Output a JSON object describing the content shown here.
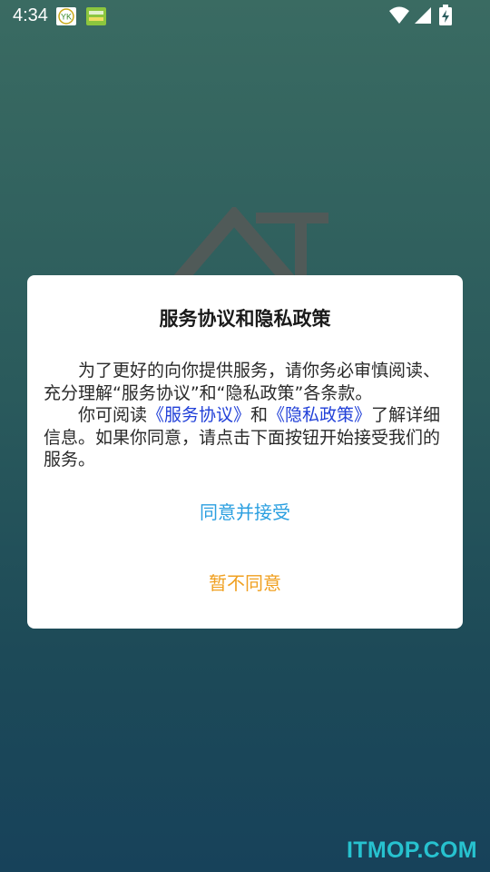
{
  "status_bar": {
    "time": "4:34",
    "app_icon_1_text": "YK",
    "app_icon_2_text": "中国"
  },
  "dialog": {
    "title": "服务协议和隐私政策",
    "para1": "为了更好的向你提供服务，请你务必审慎阅读、充分理解“服务协议”和“隐私政策”各条款。",
    "para2_prefix": "你可阅读",
    "link_service": "《服务协议》",
    "para2_and": "和",
    "link_privacy": "《隐私政策》",
    "para2_suffix": "了解详细信息。如果你同意，请点击下面按钮开始接受我们的服务。",
    "agree_label": "同意并接受",
    "disagree_label": "暂不同意"
  },
  "watermark": "ITMOP.COM",
  "colors": {
    "link": "#2140d8",
    "agree": "#2a9fe0",
    "disagree": "#f0a020",
    "watermark": "#27c2cf"
  }
}
